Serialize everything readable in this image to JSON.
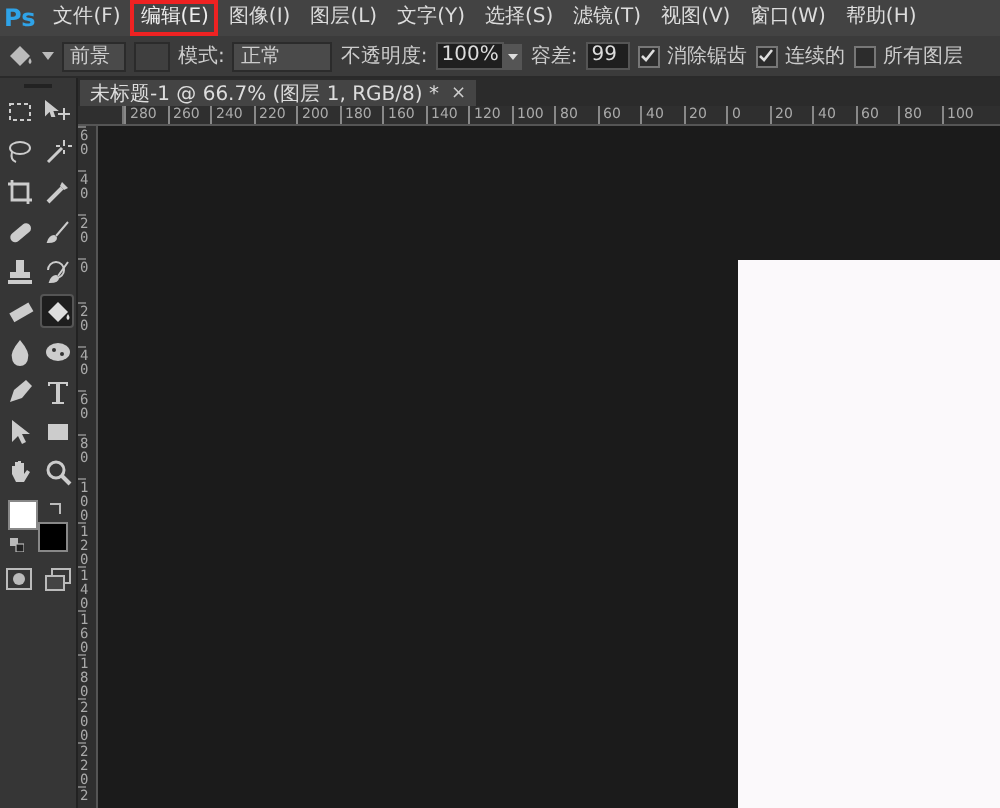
{
  "app_logo": "Ps",
  "menu": [
    {
      "label": "文件(F)",
      "highlighted": false
    },
    {
      "label": "编辑(E)",
      "highlighted": true
    },
    {
      "label": "图像(I)",
      "highlighted": false
    },
    {
      "label": "图层(L)",
      "highlighted": false
    },
    {
      "label": "文字(Y)",
      "highlighted": false
    },
    {
      "label": "选择(S)",
      "highlighted": false
    },
    {
      "label": "滤镜(T)",
      "highlighted": false
    },
    {
      "label": "视图(V)",
      "highlighted": false
    },
    {
      "label": "窗口(W)",
      "highlighted": false
    },
    {
      "label": "帮助(H)",
      "highlighted": false
    }
  ],
  "options_bar": {
    "fill_source": "前景",
    "mode_label": "模式:",
    "mode": "正常",
    "opacity_label": "不透明度:",
    "opacity": "100%",
    "tolerance_label": "容差:",
    "tolerance": "99",
    "checkboxes": [
      {
        "label": "消除锯齿",
        "checked": true
      },
      {
        "label": "连续的",
        "checked": true
      },
      {
        "label": "所有图层",
        "checked": false
      }
    ]
  },
  "document_tab": {
    "title": "未标题-1 @ 66.7% (图层 1, RGB/8) *",
    "close": "×"
  },
  "horizontal_ruler": [
    "280",
    "260",
    "240",
    "220",
    "200",
    "180",
    "160",
    "140",
    "120",
    "100",
    "80",
    "60",
    "40",
    "20",
    "0",
    "20",
    "40",
    "60",
    "80",
    "100"
  ],
  "vertical_ruler": [
    "60",
    "40",
    "20",
    "0",
    "20",
    "40",
    "60",
    "80",
    "100",
    "120",
    "140",
    "160",
    "180",
    "200",
    "220",
    "2"
  ],
  "tools": [
    {
      "kind": "marquee",
      "selected": false
    },
    {
      "kind": "move",
      "selected": false
    },
    {
      "kind": "lasso",
      "selected": false
    },
    {
      "kind": "wand",
      "selected": false
    },
    {
      "kind": "crop",
      "selected": false
    },
    {
      "kind": "eyedropper",
      "selected": false
    },
    {
      "kind": "healing",
      "selected": false
    },
    {
      "kind": "brush",
      "selected": false
    },
    {
      "kind": "stamp",
      "selected": false
    },
    {
      "kind": "history",
      "selected": false
    },
    {
      "kind": "eraser",
      "selected": false
    },
    {
      "kind": "bucket",
      "selected": true
    },
    {
      "kind": "blur",
      "selected": false
    },
    {
      "kind": "sponge",
      "selected": false
    },
    {
      "kind": "pen",
      "selected": false
    },
    {
      "kind": "type",
      "selected": false
    },
    {
      "kind": "path",
      "selected": false
    },
    {
      "kind": "rectangle",
      "selected": false
    },
    {
      "kind": "hand",
      "selected": false
    },
    {
      "kind": "zoom",
      "selected": false
    }
  ]
}
